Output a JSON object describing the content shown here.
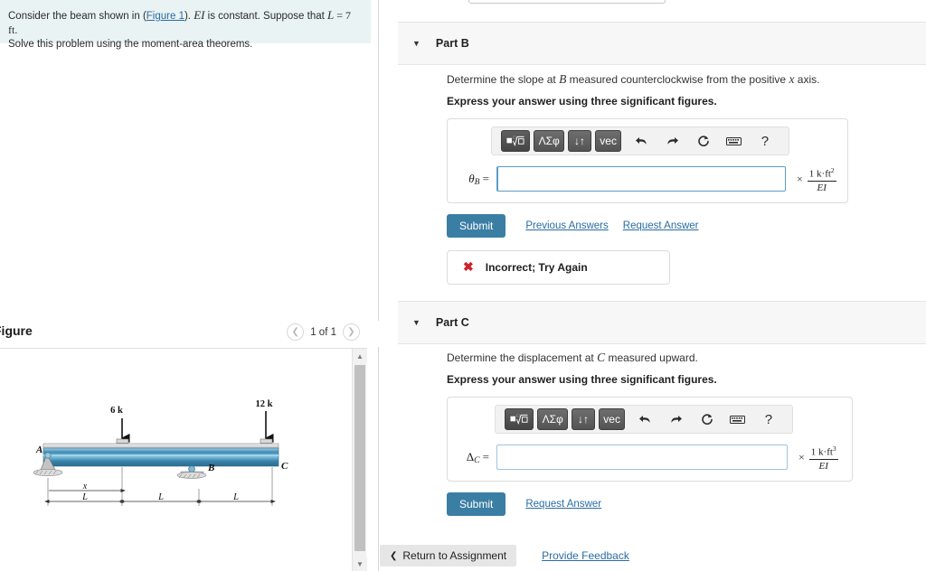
{
  "question": {
    "text_before_link": "Consider the beam shown in (",
    "figure_link": "Figure 1",
    "text_after_link": "). ",
    "ei_symbol": "EI",
    "text_mid": " is constant. Suppose that ",
    "l_symbol": "L",
    "l_value": " = 7 ft.",
    "text_line2": "Solve this problem using the moment-area theorems."
  },
  "figure": {
    "title": "Figure",
    "counter": "1 of 1",
    "prev_icon": "chevron-left-icon",
    "next_icon": "chevron-right-icon",
    "scroll_up_icon": "triangle-up-icon",
    "scroll_down_icon": "triangle-down-icon",
    "diagram": {
      "load_left_label": "6 k",
      "load_right_label": "12 k",
      "point_a": "A",
      "point_b": "B",
      "point_c": "C",
      "dim_x": "x",
      "dim_l1": "L",
      "dim_l2": "L",
      "dim_l3": "L",
      "beam_color_top": "#cfe3ee",
      "beam_color_mid": "#2f7fa8",
      "beam_color_bottom": "#7ab6d4"
    }
  },
  "parts": [
    {
      "id": "part-b",
      "label": "Part B",
      "caret_icon": "caret-down-icon",
      "prompt_pre": "Determine the slope at ",
      "prompt_var1": "B",
      "prompt_mid": " measured counterclockwise from the positive ",
      "prompt_var2": "x",
      "prompt_post": " axis.",
      "instruction": "Express your answer using three significant figures.",
      "variable": "θ",
      "variable_sub": "B",
      "equals": "=",
      "input_value": "",
      "unit_times": "×",
      "unit_numerator": "1 k·ft",
      "unit_numerator_exp": "2",
      "unit_denominator": "EI",
      "toolbar": {
        "template_label": "■√□",
        "greek_label": "ΛΣφ",
        "arrows_label": "↓↑",
        "vec_label": "vec",
        "undo_icon": "undo-arrow-icon",
        "redo_icon": "redo-arrow-icon",
        "reset_icon": "reset-circle-icon",
        "keyboard_icon": "keyboard-icon",
        "help_label": "?"
      },
      "submit_label": "Submit",
      "links": [
        "Previous Answers",
        "Request Answer"
      ],
      "feedback": {
        "icon": "error-x-icon",
        "text": "Incorrect; Try Again"
      }
    },
    {
      "id": "part-c",
      "label": "Part C",
      "caret_icon": "caret-down-icon",
      "prompt_pre": "Determine the displacement at ",
      "prompt_var1": "C",
      "prompt_mid": " measured upward.",
      "prompt_var2": "",
      "prompt_post": "",
      "instruction": "Express your answer using three significant figures.",
      "variable": "Δ",
      "variable_sub": "C",
      "equals": "=",
      "input_value": "",
      "unit_times": "×",
      "unit_numerator": "1 k·ft",
      "unit_numerator_exp": "3",
      "unit_denominator": "EI",
      "toolbar": {
        "template_label": "■√□",
        "greek_label": "ΛΣφ",
        "arrows_label": "↓↑",
        "vec_label": "vec",
        "undo_icon": "undo-arrow-icon",
        "redo_icon": "redo-arrow-icon",
        "reset_icon": "reset-circle-icon",
        "keyboard_icon": "keyboard-icon",
        "help_label": "?"
      },
      "submit_label": "Submit",
      "links": [
        "Request Answer"
      ],
      "feedback": null
    }
  ],
  "footer": {
    "return_label": "Return to Assignment",
    "return_icon": "chevron-left-icon",
    "feedback_label": "Provide Feedback"
  },
  "colors": {
    "submit_blue": "#3b7ea4",
    "link_blue": "#2b6ca3",
    "error_red": "#cf2027",
    "question_bg": "#e9f3f3",
    "part_header_bg": "#f7f7f7"
  }
}
